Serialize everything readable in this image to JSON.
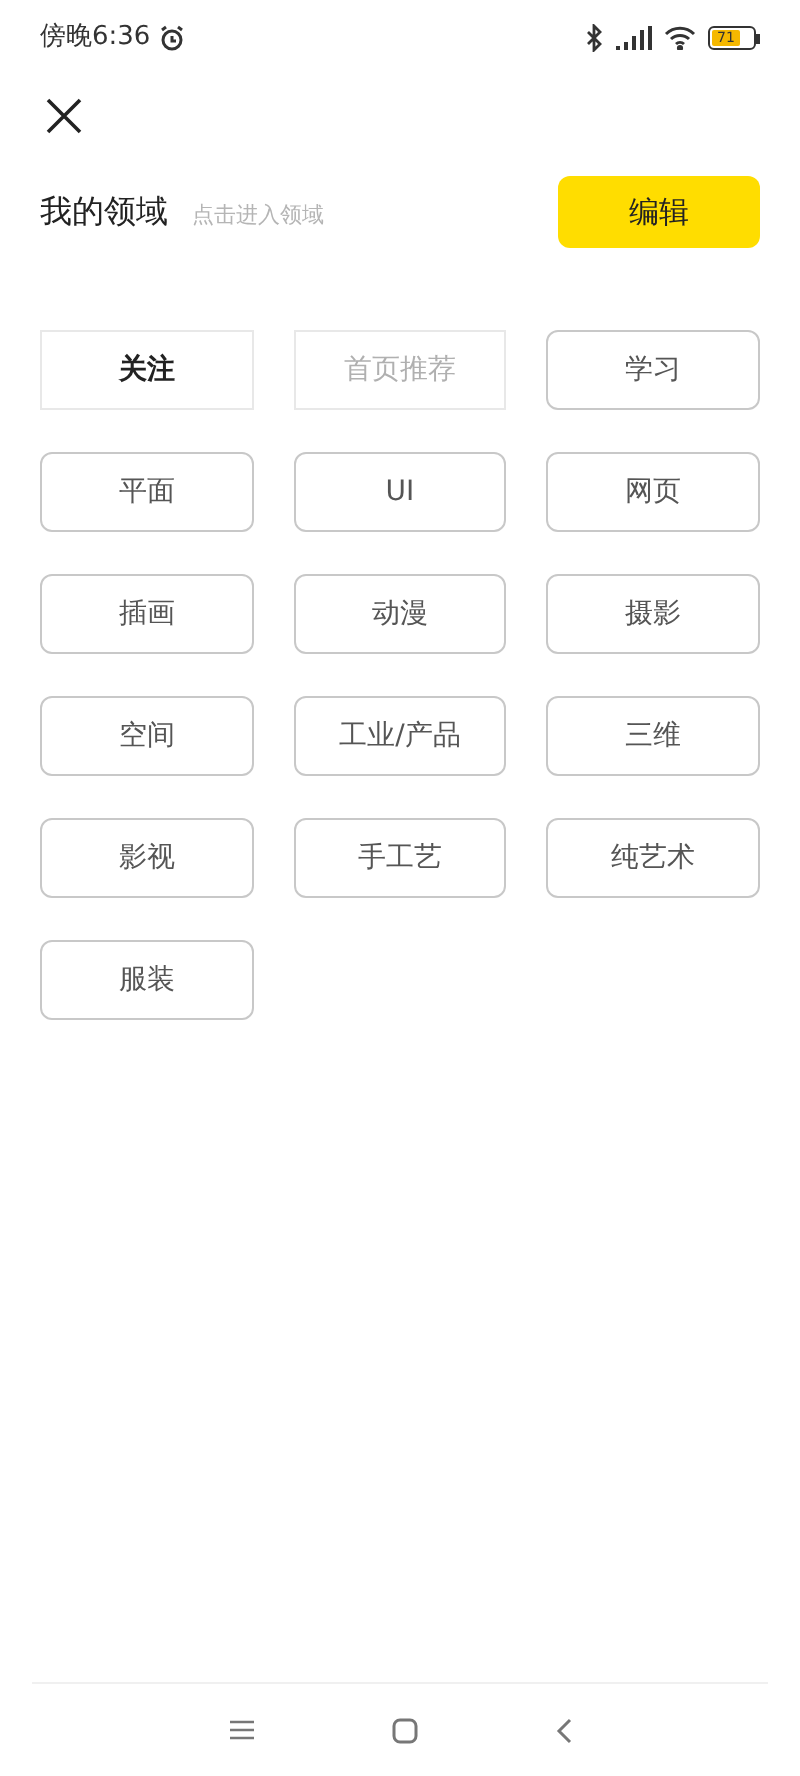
{
  "status_bar": {
    "time": "傍晚6:36",
    "battery": "71"
  },
  "header": {
    "title": "我的领域",
    "hint": "点击进入领域",
    "edit_button": "编辑"
  },
  "tags": [
    {
      "label": "关注",
      "kind": "primary"
    },
    {
      "label": "首页推荐",
      "kind": "dimmed"
    },
    {
      "label": "学习",
      "kind": "regular"
    },
    {
      "label": "平面",
      "kind": "regular"
    },
    {
      "label": "UI",
      "kind": "regular"
    },
    {
      "label": "网页",
      "kind": "regular"
    },
    {
      "label": "插画",
      "kind": "regular"
    },
    {
      "label": "动漫",
      "kind": "regular"
    },
    {
      "label": "摄影",
      "kind": "regular"
    },
    {
      "label": "空间",
      "kind": "regular"
    },
    {
      "label": "工业/产品",
      "kind": "regular"
    },
    {
      "label": "三维",
      "kind": "regular"
    },
    {
      "label": "影视",
      "kind": "regular"
    },
    {
      "label": "手工艺",
      "kind": "regular"
    },
    {
      "label": "纯艺术",
      "kind": "regular"
    },
    {
      "label": "服装",
      "kind": "regular"
    }
  ]
}
